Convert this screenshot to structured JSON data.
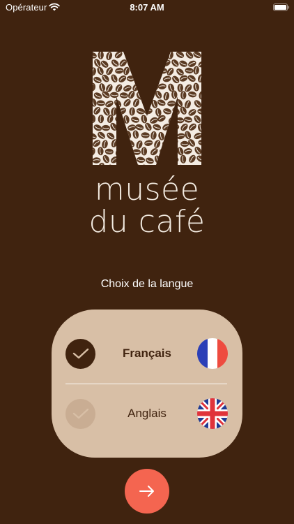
{
  "status_bar": {
    "carrier": "Opérateur",
    "time": "8:07 AM"
  },
  "brand": {
    "logo_letter": "M",
    "line1": "musée",
    "line2": "du café"
  },
  "language_picker": {
    "prompt": "Choix de la langue",
    "options": [
      {
        "label": "Français",
        "selected": true,
        "flag_icon": "france-flag-icon"
      },
      {
        "label": "Anglais",
        "selected": false,
        "flag_icon": "uk-flag-icon"
      }
    ]
  },
  "colors": {
    "background": "#40230f",
    "card": "#d8bfa6",
    "accent_button": "#f46550",
    "text_on_card": "#40230f"
  },
  "next_button": {
    "icon": "arrow-right-icon"
  }
}
